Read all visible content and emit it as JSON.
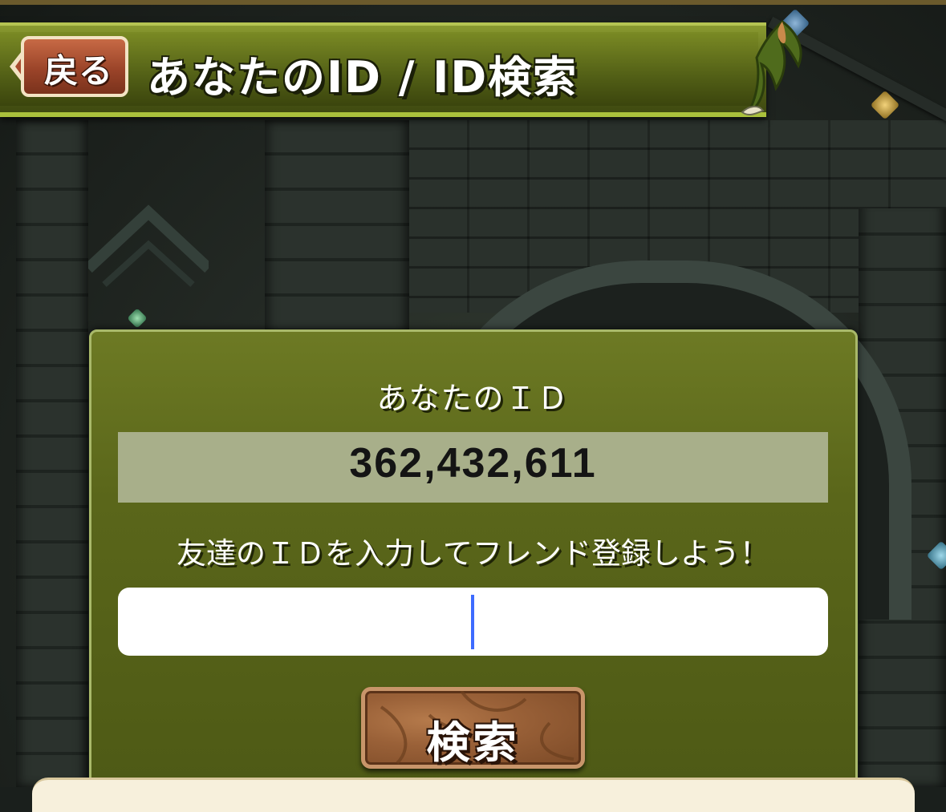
{
  "header": {
    "back_label": "戻る",
    "title": "あなたのID / ID検索"
  },
  "panel": {
    "your_id_label": "あなたのＩＤ",
    "your_id_value": "362,432,611",
    "prompt": "友達のＩＤを入力してフレンド登録しよう！",
    "input_value": "",
    "search_label": "検索"
  },
  "colors": {
    "header_green": "#5d6c1c",
    "panel_green": "#5a661a",
    "back_button": "#9b4429",
    "search_button": "#9a6138",
    "caret": "#3d6bff"
  },
  "icons": [
    "back-arrow-icon",
    "dragon-wing-icon",
    "gem-icon"
  ]
}
